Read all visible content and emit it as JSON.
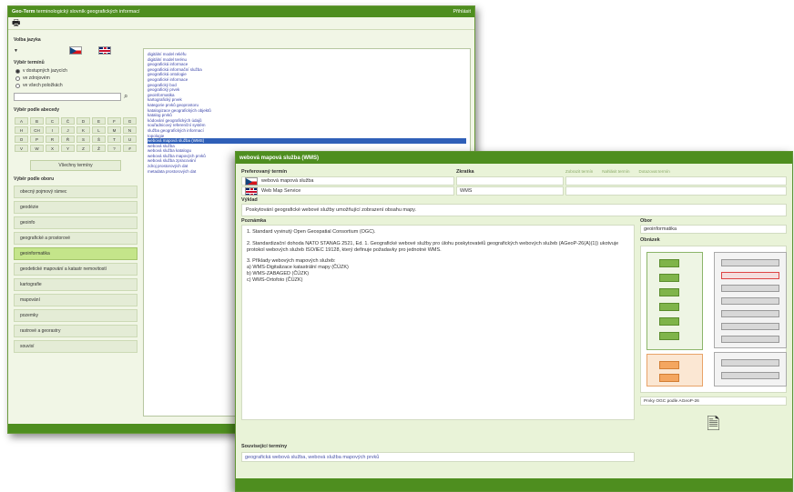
{
  "back_window": {
    "app_title": "Geo-Term",
    "subtitle": "terminologický slovník geografických informací",
    "login": "Přihlásit",
    "search_label": "Volba jazyka",
    "lang_label": "Výběr termínů",
    "radio_options": [
      "v dostupných jazycích",
      "ve zdrojovém",
      "ve všech položkách"
    ],
    "alphabet_label": "Výběr podle abecedy",
    "alphabet": [
      "A",
      "B",
      "C",
      "Č",
      "D",
      "E",
      "F",
      "G",
      "H",
      "CH",
      "I",
      "J",
      "K",
      "L",
      "M",
      "N",
      "O",
      "P",
      "R",
      "Ř",
      "S",
      "Š",
      "T",
      "U",
      "V",
      "W",
      "X",
      "Y",
      "Z",
      "Ž",
      "?",
      "#"
    ],
    "all_terms_btn": "Všechny termíny",
    "category_label": "Výběr podle oboru",
    "categories": [
      "obecný pojmový rámec",
      "geodézie",
      "geoinfo",
      "geografické a prostorové",
      "geoinformatika",
      "geodetické mapování a katastr nemovitostí",
      "kartografie",
      "mapování",
      "pozemky",
      "rastrové a georastry",
      "souvisí"
    ],
    "active_category_index": 4,
    "terms": [
      "digitální model reliéfu",
      "digitální model terénu",
      "geografická informace",
      "geografická informační služba",
      "geografická ontologie",
      "geografické informace",
      "geografický bod",
      "geografický prvek",
      "geoinformatika",
      "kartografický prvek",
      "kategorie prvků geoprostoru",
      "katalogizace geografických objektů",
      "katalog prvků",
      "kódování geografických údajů",
      "souřadnicový referenční systém",
      "služba geografických informací",
      "topologie",
      "webová mapová služba (WMS)",
      "webová služba",
      "webová služba katalogu",
      "webová služba mapových prvků",
      "webová služba zpracování",
      "zdroj prostorových dat",
      "metadata prostorových dat"
    ],
    "selected_term_index": 17
  },
  "front_window": {
    "title": "webová mapová služba (WMS)",
    "col_term": "Preferovaný termín",
    "col_abbr": "Zkratka",
    "links": [
      "Zobrazit termín",
      "Nahlásit termín",
      "Dotazovat termín"
    ],
    "term_cs": "webová mapová služba",
    "term_en": "Web Map Service",
    "abbr_cs": "",
    "abbr_en": "WMS",
    "summary_label": "Výklad",
    "summary": "Poskytování geografické webové služby umožňující zobrazení obsahu mapy.",
    "definition_label": "Poznámka",
    "definition_paragraphs": [
      "1. Standard vyvinutý Open Geospatial Consortium (OGC).",
      "2. Standardizační dohoda NATO STANAG 2521, Ed. 1. Geografické webové služby pro úlohu poskytovatelů geografických webových služeb (AGeoP-26(A)(1)) ukotvuje protokol webových služeb ISO/IEC 19128, který definuje požadavky pro jednotné WMS.",
      "3. Příklady webových mapových služeb:\na) WMS-Digitalizace katastrální mapy (ČÚZK)\nb) WMS-ZABAGED (ČÚZK)\nc) WMS-Ortofoto (ČÚZK)"
    ],
    "field_label": "Obor",
    "field_value": "geoinformatika",
    "image_label": "Obrázek",
    "image_source": "Prvky OGC podle AGeoP-26",
    "related_label": "Související termíny",
    "related_terms": "geografická webová služba, webová služba mapových prvků"
  }
}
